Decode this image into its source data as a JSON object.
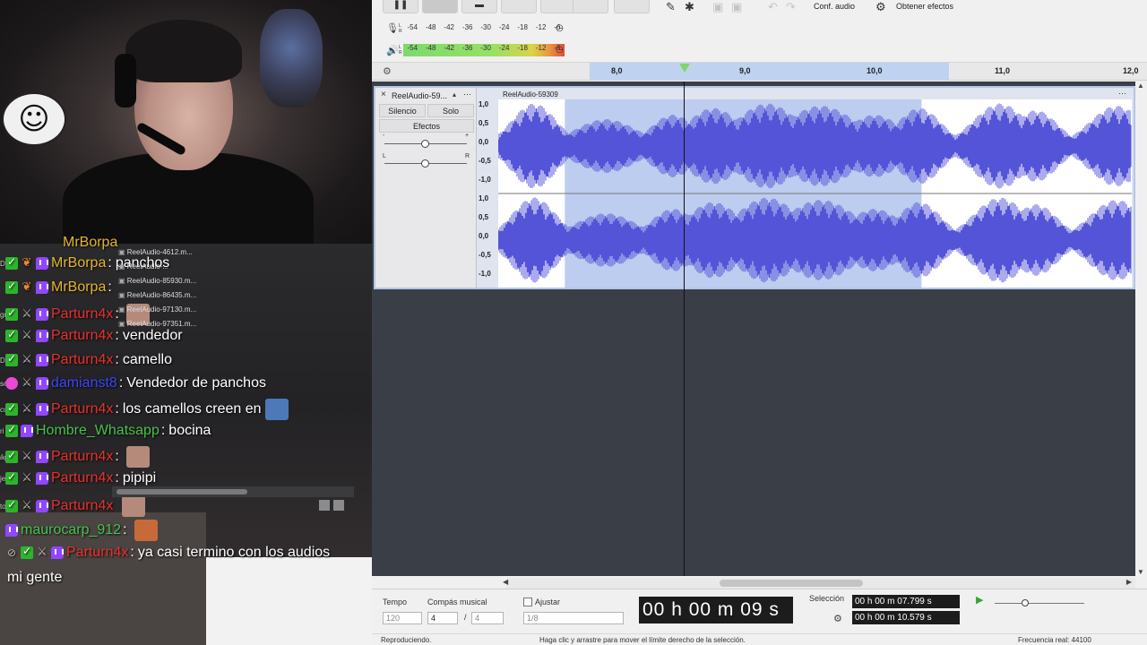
{
  "stream": {
    "chat": [
      {
        "badges": [
          "vip",
          "bear",
          "twitch"
        ],
        "user": "MrBorpa",
        "user_color": "gold",
        "sep": ":",
        "text": "panchos",
        "left_note": "DEN RING"
      },
      {
        "badges": [
          "vip",
          "bear",
          "twitch"
        ],
        "user": "MrBorpa",
        "user_color": "gold",
        "sep": ":",
        "text": "",
        "left_note": ""
      },
      {
        "badges": [
          "vip",
          "mod",
          "twitch"
        ],
        "user": "Parturn4x",
        "user_color": "red",
        "sep": ":",
        "text": "",
        "left_note": "gros new"
      },
      {
        "badges": [
          "vip",
          "mod",
          "twitch"
        ],
        "user": "Parturn4x",
        "user_color": "red",
        "sep": ":",
        "text": "vendedor",
        "left_note": ""
      },
      {
        "badges": [
          "vip",
          "mod",
          "twitch"
        ],
        "user": "Parturn4x",
        "user_color": "red",
        "sep": ":",
        "text": "camello",
        "left_note": "D"
      },
      {
        "badges": [
          "heart",
          "mod",
          "twitch"
        ],
        "user": "damianst8",
        "user_color": "blue",
        "sep": ":",
        "text": "Vendedor de panchos",
        "left_note": "scargas"
      },
      {
        "badges": [
          "vip",
          "mod",
          "twitch"
        ],
        "user": "Parturn4x",
        "user_color": "red",
        "sep": ":",
        "text": "los camellos creen en",
        "left_note": "cu"
      },
      {
        "badges": [
          "vip",
          "twitch"
        ],
        "user": "Hombre_Whatsapp",
        "user_color": "green",
        "sep": ":",
        "text": "bocina",
        "left_note": "ri"
      },
      {
        "badges": [
          "vip",
          "mod",
          "twitch"
        ],
        "user": "Parturn4x",
        "user_color": "red",
        "sep": ":",
        "text": "",
        "left_note": "ágenes"
      },
      {
        "badges": [
          "vip",
          "mod",
          "twitch"
        ],
        "user": "Parturn4x",
        "user_color": "red",
        "sep": ":",
        "text": "pipipi",
        "left_note": "je"
      },
      {
        "badges": [
          "vip",
          "mod",
          "twitch"
        ],
        "user": "Parturn4x",
        "user_color": "red",
        "sep": "",
        "text": "",
        "left_note": "to"
      },
      {
        "badges": [
          "twitch"
        ],
        "user": "maurocarp_912",
        "user_color": "green",
        "sep": ":",
        "text": "",
        "left_note": ""
      },
      {
        "badges": [
          "hide",
          "vip",
          "mod",
          "twitch"
        ],
        "user": "Parturn4x",
        "user_color": "red",
        "sep": ":",
        "text": "ya casi termino con los audios",
        "left_note": ""
      }
    ],
    "chat_continuation": "mi gente",
    "overlap_user": "MrBorpa",
    "file_popup": [
      "ReelAudio-4612.m...",
      "ReelAudio-...",
      "ReelAudio-85930.m...",
      "ReelAudio-86435.m...",
      "ReelAudio-97130.m...",
      "ReelAudio-97351.m..."
    ]
  },
  "audacity": {
    "toolbar": {
      "audio_setup": "Conf. audio",
      "get_effects": "Obtener efectos",
      "record_meter_scale": [
        "-54",
        "-48",
        "-42",
        "-36",
        "-30",
        "-24",
        "-18",
        "-12",
        "-6"
      ],
      "play_meter_scale": [
        "-54",
        "-48",
        "-42",
        "-36",
        "-30",
        "-24",
        "-18",
        "-12",
        "-6"
      ],
      "meter_lr": [
        "L",
        "R"
      ]
    },
    "ruler": {
      "labels": [
        "8,0",
        "9,0",
        "10,0",
        "11,0",
        "12,0"
      ],
      "selection_start_s": 7.799,
      "selection_end_s": 10.579
    },
    "track": {
      "name": "ReelAudio-59...",
      "clip_name": "ReelAudio-59309",
      "mute": "Silencio",
      "solo": "Solo",
      "effects": "Efectos",
      "gain_minus": "-",
      "gain_plus": "+",
      "pan_left": "L",
      "pan_right": "R",
      "close_icon": "×",
      "menu_icon": "⋯",
      "collapse_icon": "▴",
      "vscale_top": [
        "1,0",
        "0,5",
        "0,0",
        "-0,5",
        "-1,0"
      ],
      "vscale_bottom": [
        "1,0",
        "0,5",
        "0,0",
        "-0,5",
        "-1,0"
      ]
    },
    "bottom": {
      "tempo_label": "Tempo",
      "tempo_value": "120",
      "meter_label": "Compás musical",
      "meter_num": "4",
      "meter_sep": "/",
      "meter_den": "4",
      "snap_label": "Ajustar",
      "snap_value": "1/8",
      "time_big": "00 h 00 m 09 s",
      "selection_label": "Selección",
      "sel_start": "00 h 00 m 07.799 s",
      "sel_end": "00 h 00 m 10.579 s"
    },
    "status": {
      "left": "Reproduciendo.",
      "center": "Haga clic y arrastre para mover el límite derecho de la selección.",
      "right": "Frecuencia real: 44100"
    }
  }
}
